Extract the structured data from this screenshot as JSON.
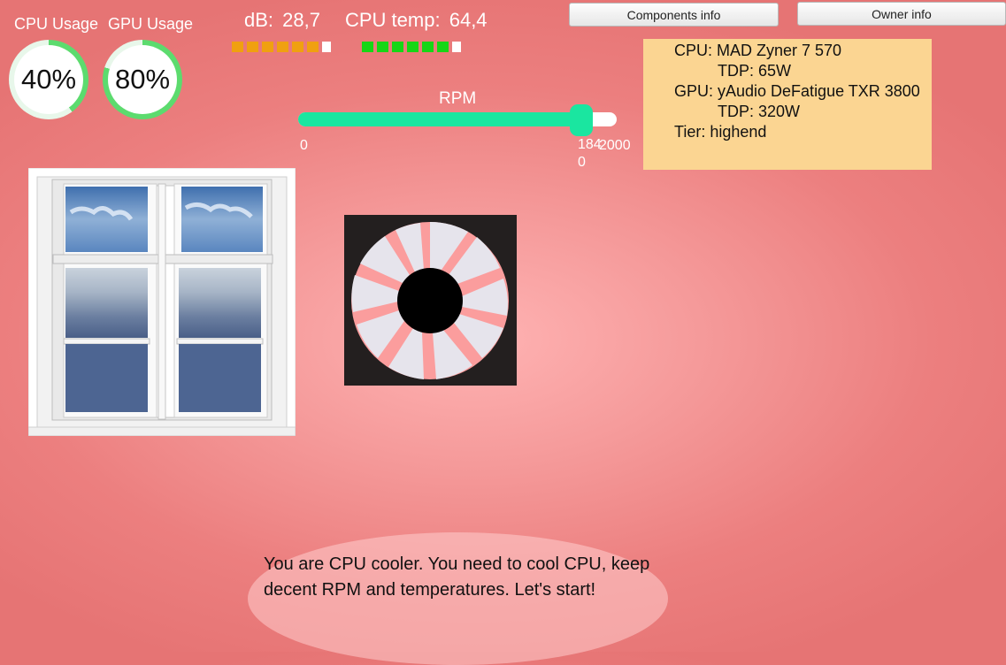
{
  "gauges": [
    {
      "label": "CPU Usage",
      "value": "40%",
      "fraction": 0.4,
      "color": "#5cdb6e"
    },
    {
      "label": "GPU Usage",
      "value": "80%",
      "fraction": 0.8,
      "color": "#5cdb6e"
    }
  ],
  "meters": {
    "db": {
      "label": "dB:",
      "value": "28,7",
      "filled_segments": 6,
      "total_segments": 7,
      "color": "#f0a010"
    },
    "temp": {
      "label": "CPU temp:",
      "value": "64,4",
      "filled_segments": 6,
      "total_segments": 7,
      "color": "#16d616"
    }
  },
  "buttons": {
    "components": "Components info",
    "owner": "Owner info"
  },
  "info_panel": {
    "cpu_line": "CPU: MAD Zyner 7 570",
    "cpu_tdp": "TDP: 65W",
    "gpu_line": "GPU: yAudio DeFatigue TXR 3800",
    "gpu_tdp": "TDP: 320W",
    "tier": "Tier: highend"
  },
  "rpm": {
    "label": "RPM",
    "min": "0",
    "max": "2000",
    "current_value": "1840",
    "fraction": 0.92
  },
  "dialog": {
    "text": "You are CPU cooler. You need to cool CPU, keep decent RPM and temperatures. Let's start!"
  },
  "colors": {
    "accent_green": "#1ae6a0",
    "panel": "#fbd592"
  }
}
